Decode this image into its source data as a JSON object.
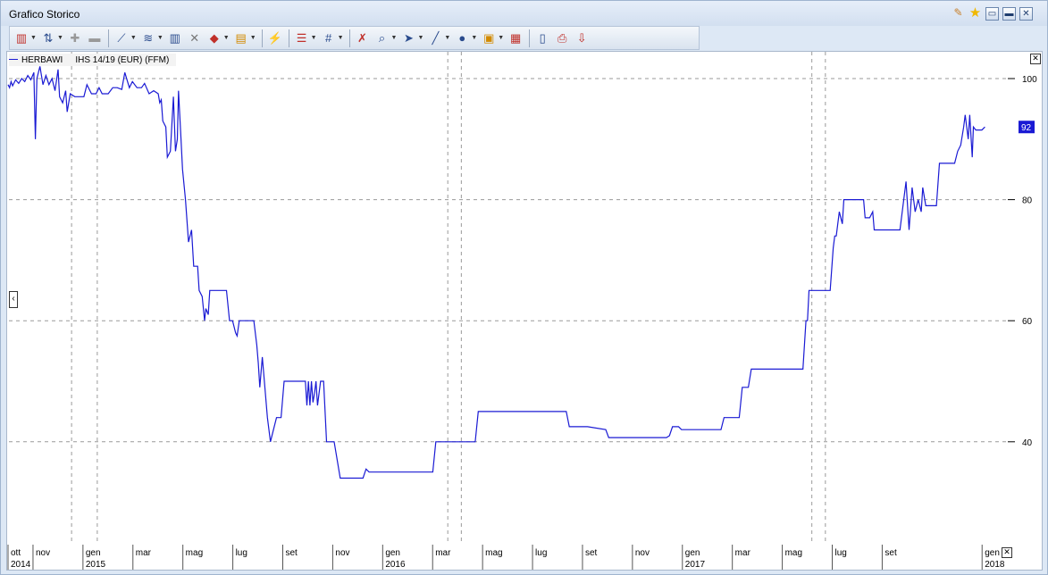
{
  "window": {
    "title": "Grafico Storico"
  },
  "toolbar": {
    "icons": [
      "chart-type-icon",
      "compare-icon",
      "add-study-icon",
      "remove-study-icon",
      "indicators-icon",
      "trendline-icon",
      "bar-style-icon",
      "crossline-icon",
      "candlestick-icon",
      "data-icon",
      "volume-icon",
      "grid-style-icon",
      "grid-icon",
      "delete-drawing-icon",
      "zoom-icon",
      "pointer-icon",
      "line-draw-icon",
      "color-icon",
      "image-icon",
      "clear-icon",
      "clipboard-icon",
      "print-icon",
      "export-icon"
    ]
  },
  "legend": {
    "items": [
      "HERBAWI",
      "IHS 14/19 (EUR) (FFM)"
    ],
    "line_color": "#1a1ad4"
  },
  "last_value_label": "92",
  "chart_data": {
    "type": "line",
    "series": [
      {
        "name": "HERBAWI",
        "color": "#1a1ad4"
      }
    ],
    "x_unit": "months since Oct 2014",
    "ylim": [
      34,
      102.5
    ],
    "y_ticks": [
      "100",
      "80",
      "60",
      "40"
    ],
    "x_ticks": [
      {
        "label": "ott",
        "year": "2014"
      },
      {
        "label": "nov",
        "year": ""
      },
      {
        "label": "gen",
        "year": "2015"
      },
      {
        "label": "mar",
        "year": ""
      },
      {
        "label": "mag",
        "year": ""
      },
      {
        "label": "lug",
        "year": ""
      },
      {
        "label": "set",
        "year": ""
      },
      {
        "label": "nov",
        "year": ""
      },
      {
        "label": "gen",
        "year": "2016"
      },
      {
        "label": "mar",
        "year": ""
      },
      {
        "label": "mag",
        "year": ""
      },
      {
        "label": "lug",
        "year": ""
      },
      {
        "label": "set",
        "year": ""
      },
      {
        "label": "nov",
        "year": ""
      },
      {
        "label": "gen",
        "year": "2017"
      },
      {
        "label": "mar",
        "year": ""
      },
      {
        "label": "mag",
        "year": ""
      },
      {
        "label": "lug",
        "year": ""
      },
      {
        "label": "set",
        "year": ""
      },
      {
        "label": "gen",
        "year": "2018"
      }
    ],
    "grid": true,
    "grid_style": "dashed",
    "points": [
      [
        0.0,
        99
      ],
      [
        0.05,
        98.5
      ],
      [
        0.1,
        99.5
      ],
      [
        0.15,
        98.8
      ],
      [
        0.25,
        99.8
      ],
      [
        0.35,
        99.2
      ],
      [
        0.45,
        100
      ],
      [
        0.55,
        99.5
      ],
      [
        0.65,
        100.5
      ],
      [
        0.75,
        99.8
      ],
      [
        0.85,
        101
      ],
      [
        0.9,
        90
      ],
      [
        0.95,
        100
      ],
      [
        1.05,
        102
      ],
      [
        1.15,
        99
      ],
      [
        1.25,
        100.5
      ],
      [
        1.35,
        99
      ],
      [
        1.45,
        100
      ],
      [
        1.55,
        98
      ],
      [
        1.65,
        101.5
      ],
      [
        1.7,
        97
      ],
      [
        1.8,
        96
      ],
      [
        1.9,
        98
      ],
      [
        1.95,
        94.5
      ],
      [
        2.05,
        97.5
      ],
      [
        2.2,
        97
      ],
      [
        2.5,
        97
      ],
      [
        2.6,
        99
      ],
      [
        2.75,
        97.5
      ],
      [
        2.9,
        97.5
      ],
      [
        3.0,
        98.5
      ],
      [
        3.1,
        97.5
      ],
      [
        3.3,
        97.5
      ],
      [
        3.45,
        98.5
      ],
      [
        3.6,
        98.5
      ],
      [
        3.75,
        98.2
      ],
      [
        3.85,
        101
      ],
      [
        4.0,
        98.5
      ],
      [
        4.1,
        99.5
      ],
      [
        4.25,
        98.5
      ],
      [
        4.4,
        98.5
      ],
      [
        4.5,
        99.2
      ],
      [
        4.65,
        97.5
      ],
      [
        4.8,
        98
      ],
      [
        4.95,
        97.5
      ],
      [
        5.0,
        96
      ],
      [
        5.05,
        96.5
      ],
      [
        5.1,
        93
      ],
      [
        5.2,
        92
      ],
      [
        5.25,
        87
      ],
      [
        5.35,
        88
      ],
      [
        5.45,
        97
      ],
      [
        5.52,
        88
      ],
      [
        5.58,
        90
      ],
      [
        5.62,
        98
      ],
      [
        5.7,
        90
      ],
      [
        5.75,
        85
      ],
      [
        5.85,
        80
      ],
      [
        5.95,
        73
      ],
      [
        6.05,
        75
      ],
      [
        6.12,
        69
      ],
      [
        6.25,
        69
      ],
      [
        6.3,
        65
      ],
      [
        6.4,
        64
      ],
      [
        6.48,
        60
      ],
      [
        6.52,
        62
      ],
      [
        6.6,
        61
      ],
      [
        6.65,
        65
      ],
      [
        6.9,
        65
      ],
      [
        7.0,
        65
      ],
      [
        7.2,
        65
      ],
      [
        7.3,
        60
      ],
      [
        7.4,
        60
      ],
      [
        7.5,
        58
      ],
      [
        7.55,
        57.5
      ],
      [
        7.62,
        60
      ],
      [
        8.05,
        60
      ],
      [
        8.1,
        60
      ],
      [
        8.2,
        56
      ],
      [
        8.25,
        53
      ],
      [
        8.3,
        49
      ],
      [
        8.38,
        54
      ],
      [
        8.45,
        50
      ],
      [
        8.55,
        44
      ],
      [
        8.65,
        40
      ],
      [
        8.75,
        42
      ],
      [
        8.85,
        44
      ],
      [
        9.0,
        44
      ],
      [
        9.1,
        50
      ],
      [
        9.7,
        50
      ],
      [
        9.8,
        50
      ],
      [
        9.85,
        46
      ],
      [
        9.9,
        50
      ],
      [
        9.95,
        46
      ],
      [
        10.0,
        50
      ],
      [
        10.05,
        46.5
      ],
      [
        10.1,
        48
      ],
      [
        10.15,
        50
      ],
      [
        10.2,
        46
      ],
      [
        10.25,
        48
      ],
      [
        10.3,
        50
      ],
      [
        10.4,
        50
      ],
      [
        10.5,
        40
      ],
      [
        10.75,
        40
      ],
      [
        10.85,
        37
      ],
      [
        10.95,
        34
      ],
      [
        11.05,
        34
      ],
      [
        11.5,
        34
      ],
      [
        11.7,
        34
      ],
      [
        11.8,
        35.5
      ],
      [
        11.9,
        35
      ],
      [
        12.5,
        35
      ],
      [
        13.3,
        35
      ],
      [
        13.7,
        35
      ],
      [
        14.0,
        35
      ],
      [
        14.1,
        40
      ],
      [
        14.8,
        40
      ],
      [
        15.2,
        40
      ],
      [
        15.4,
        40
      ],
      [
        15.5,
        45
      ],
      [
        18.2,
        45
      ],
      [
        18.4,
        45
      ],
      [
        18.5,
        42.5
      ],
      [
        18.9,
        42.5
      ],
      [
        19.1,
        42.5
      ],
      [
        19.7,
        42
      ],
      [
        19.8,
        40.7
      ],
      [
        20.4,
        40.7
      ],
      [
        21.5,
        40.7
      ],
      [
        21.7,
        40.7
      ],
      [
        21.8,
        41
      ],
      [
        21.9,
        42.5
      ],
      [
        22.1,
        42.5
      ],
      [
        22.2,
        42
      ],
      [
        23.2,
        42
      ],
      [
        23.5,
        42
      ],
      [
        23.6,
        44
      ],
      [
        23.9,
        44
      ],
      [
        24.1,
        44
      ],
      [
        24.2,
        49
      ],
      [
        24.4,
        49
      ],
      [
        24.5,
        52
      ],
      [
        24.7,
        52
      ],
      [
        26.0,
        52
      ],
      [
        26.2,
        52
      ],
      [
        26.3,
        60
      ],
      [
        26.35,
        60
      ],
      [
        26.4,
        65
      ],
      [
        26.8,
        65
      ],
      [
        27.1,
        65
      ],
      [
        27.2,
        72
      ],
      [
        27.25,
        74
      ],
      [
        27.3,
        74
      ],
      [
        27.4,
        78
      ],
      [
        27.5,
        76
      ],
      [
        27.55,
        80
      ],
      [
        27.8,
        80
      ],
      [
        28.1,
        80
      ],
      [
        28.2,
        80
      ],
      [
        28.25,
        77
      ],
      [
        28.4,
        77
      ],
      [
        28.5,
        78
      ],
      [
        28.55,
        75
      ],
      [
        28.7,
        75
      ],
      [
        29.2,
        75
      ],
      [
        29.4,
        75
      ],
      [
        29.6,
        83
      ],
      [
        29.7,
        75
      ],
      [
        29.8,
        82
      ],
      [
        29.9,
        78
      ],
      [
        30.0,
        80
      ],
      [
        30.1,
        78
      ],
      [
        30.15,
        82
      ],
      [
        30.25,
        79
      ],
      [
        30.4,
        79
      ],
      [
        30.5,
        79
      ],
      [
        30.6,
        79
      ],
      [
        30.7,
        86
      ],
      [
        30.8,
        86
      ],
      [
        31.1,
        86
      ],
      [
        31.2,
        86
      ],
      [
        31.3,
        88
      ],
      [
        31.4,
        89
      ],
      [
        31.5,
        92
      ],
      [
        31.55,
        94
      ],
      [
        31.65,
        90
      ],
      [
        31.7,
        94
      ],
      [
        31.78,
        87
      ],
      [
        31.82,
        92
      ],
      [
        31.9,
        91.5
      ],
      [
        32.1,
        91.5
      ],
      [
        32.2,
        92
      ]
    ]
  }
}
